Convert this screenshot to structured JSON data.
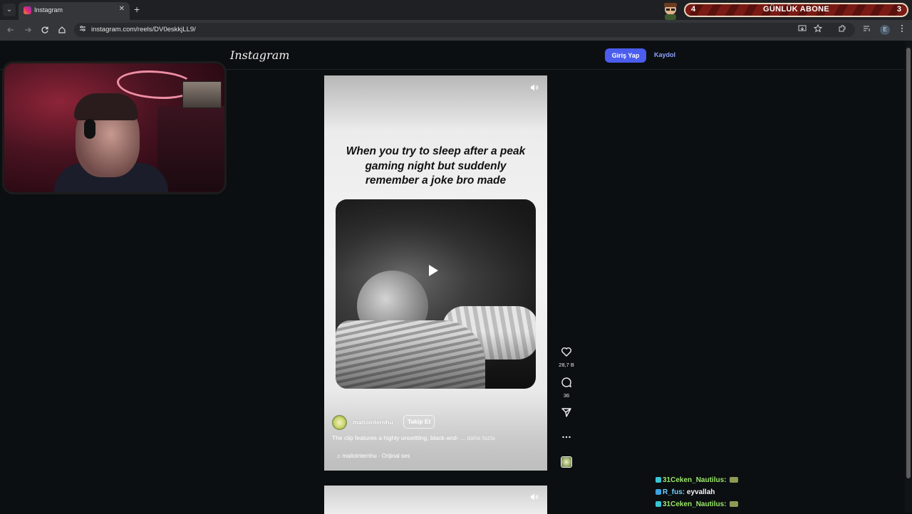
{
  "browser": {
    "tab_title": "Instagram",
    "tab_close": "✕",
    "new_tab": "+",
    "tab_switcher": "⌄",
    "url": "instagram.com/reels/DV0eskkjLL9/",
    "profile_initial": "E"
  },
  "stream_overlay": {
    "left_count": "4",
    "label": "GÜNLÜK ABONE",
    "right_count": "3"
  },
  "header": {
    "logo": "Instagram",
    "login_label": "Giriş Yap",
    "signup_label": "Kaydol"
  },
  "reel": {
    "caption": "When you try to sleep after a peak gaming night but suddenly remember a joke bro made",
    "username": "maitointernhu",
    "follow_label": "Takip Et",
    "description": "The clip features a highly unsettling, black-and- ...",
    "more_label": "daha fazla",
    "audio": "♫ maitointernhu · Orijinal ses"
  },
  "actions": {
    "likes": "28,7 B",
    "comments": "36"
  },
  "chat": [
    {
      "user": "31Ceken_Nautilus:",
      "message": "",
      "color": "green"
    },
    {
      "user": "R_fus:",
      "message": "eyvallah",
      "color": "blue"
    },
    {
      "user": "31Ceken_Nautilus:",
      "message": "",
      "color": "green"
    }
  ]
}
